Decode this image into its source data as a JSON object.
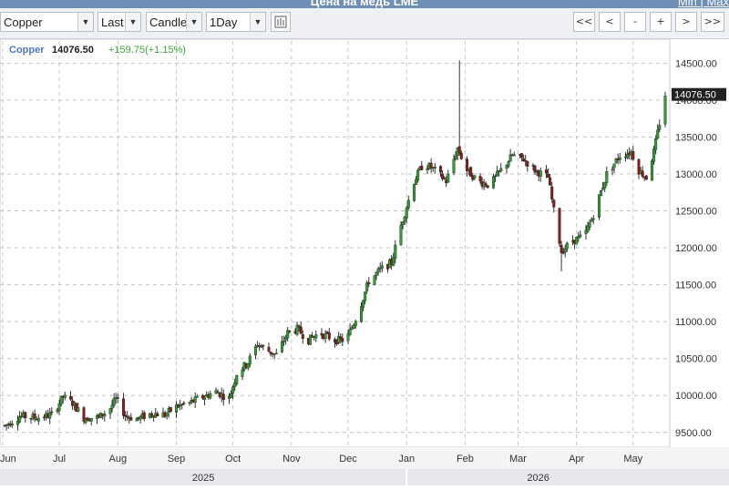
{
  "window": {
    "title": "Цена на медь LME",
    "links_text": "Min | Max"
  },
  "toolbar": {
    "symbol": "Copper",
    "price_field": "Last",
    "chart_style": "Candle",
    "interval": "1Day",
    "chart_style_icon": "bar-chart-icon",
    "nav_buttons": [
      "<<",
      "<",
      "-",
      "+",
      ">",
      ">>"
    ]
  },
  "legend": {
    "symbol": "Copper",
    "last": "14076.50",
    "change": "+159.75(+1.15%)",
    "symbol_color": "#4a78c4",
    "change_color": "#3aa63a"
  },
  "chart_data": {
    "type": "candlestick",
    "symbol": "Copper",
    "last_price": 14076.5,
    "last_price_label": "14076.50",
    "y_ticks": [
      "9500.00",
      "10000.00",
      "10500.00",
      "11000.00",
      "11500.00",
      "12000.00",
      "12500.00",
      "13000.00",
      "13500.00",
      "14000.00",
      "14500.00"
    ],
    "ylim": [
      9300,
      14800
    ],
    "x_month_labels": [
      "Jun",
      "Jul",
      "Aug",
      "Sep",
      "Oct",
      "Nov",
      "Dec",
      "Jan",
      "Feb",
      "Mar",
      "Apr",
      "May"
    ],
    "x_year_labels": [
      "2025",
      "2026"
    ],
    "grid": true,
    "colors": {
      "up": "#2e9e2e",
      "down": "#8e1a1a",
      "wick": "#333333"
    },
    "series_anchors": [
      [
        "2025-06-02",
        9590
      ],
      [
        "2025-06-10",
        9720
      ],
      [
        "2025-06-20",
        9700
      ],
      [
        "2025-06-27",
        9740
      ],
      [
        "2025-07-03",
        9980
      ],
      [
        "2025-07-08",
        9900
      ],
      [
        "2025-07-14",
        9700
      ],
      [
        "2025-07-22",
        9700
      ],
      [
        "2025-07-28",
        9830
      ],
      [
        "2025-07-31",
        9950
      ],
      [
        "2025-08-05",
        9730
      ],
      [
        "2025-08-11",
        9680
      ],
      [
        "2025-08-19",
        9760
      ],
      [
        "2025-08-26",
        9740
      ],
      [
        "2025-09-01",
        9850
      ],
      [
        "2025-09-08",
        9900
      ],
      [
        "2025-09-15",
        9980
      ],
      [
        "2025-09-22",
        10050
      ],
      [
        "2025-09-29",
        9960
      ],
      [
        "2025-10-03",
        10300
      ],
      [
        "2025-10-09",
        10450
      ],
      [
        "2025-10-14",
        10700
      ],
      [
        "2025-10-20",
        10600
      ],
      [
        "2025-10-24",
        10550
      ],
      [
        "2025-10-30",
        10850
      ],
      [
        "2025-11-04",
        10900
      ],
      [
        "2025-11-10",
        10750
      ],
      [
        "2025-11-16",
        10850
      ],
      [
        "2025-11-24",
        10750
      ],
      [
        "2025-11-30",
        10750
      ],
      [
        "2025-12-06",
        11100
      ],
      [
        "2025-12-12",
        11550
      ],
      [
        "2025-12-18",
        11700
      ],
      [
        "2025-12-24",
        11800
      ],
      [
        "2025-12-29",
        12300
      ],
      [
        "2026-01-05",
        12900
      ],
      [
        "2026-01-10",
        13150
      ],
      [
        "2026-01-16",
        13050
      ],
      [
        "2026-01-22",
        12900
      ],
      [
        "2026-01-28",
        13350
      ],
      [
        "2026-02-02",
        13050
      ],
      [
        "2026-02-08",
        12900
      ],
      [
        "2026-02-14",
        12850
      ],
      [
        "2026-02-20",
        13050
      ],
      [
        "2026-02-26",
        13250
      ],
      [
        "2026-03-04",
        13200
      ],
      [
        "2026-03-10",
        13050
      ],
      [
        "2026-03-17",
        12950
      ],
      [
        "2026-03-20",
        12500
      ],
      [
        "2026-03-24",
        11950
      ],
      [
        "2026-03-30",
        12100
      ],
      [
        "2026-04-05",
        12150
      ],
      [
        "2026-04-10",
        12450
      ],
      [
        "2026-04-17",
        13000
      ],
      [
        "2026-04-24",
        13250
      ],
      [
        "2026-04-30",
        13300
      ],
      [
        "2026-05-04",
        13050
      ],
      [
        "2026-05-08",
        12950
      ],
      [
        "2026-05-12",
        13300
      ],
      [
        "2026-05-18",
        14076.5
      ]
    ],
    "x_start": "2025-06-02",
    "x_end": "2026-05-18"
  }
}
